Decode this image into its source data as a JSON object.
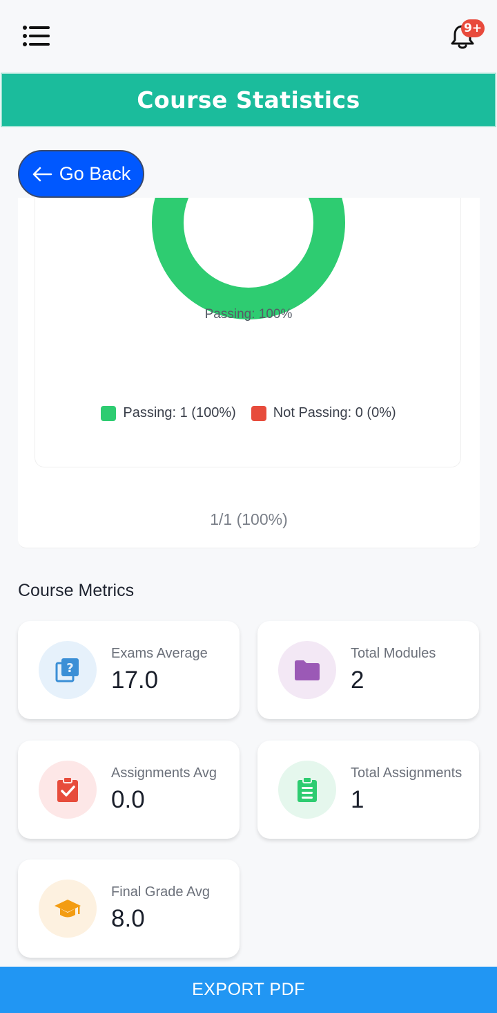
{
  "header": {
    "menu_icon": "menu-list-icon",
    "notification_icon": "bell-icon",
    "notification_badge": "9+",
    "title": "Course Statistics"
  },
  "go_back": {
    "label": "Go Back",
    "icon": "arrow-left-icon"
  },
  "chart_data": {
    "type": "pie",
    "categories": [
      "Passing",
      "Not Passing"
    ],
    "values": [
      1,
      0
    ],
    "percents": [
      100,
      0
    ],
    "colors": [
      "#2ecc71",
      "#e74c3c"
    ],
    "slice_label": "Passing: 100%",
    "legend": [
      "Passing: 1 (100%)",
      "Not Passing: 0 (0%)"
    ],
    "summary": "1/1 (100%)"
  },
  "metrics": {
    "title": "Course Metrics",
    "items": [
      {
        "label": "Exams Average",
        "value": "17.0",
        "icon": "quiz-icon",
        "icon_color": "#3b8fd6",
        "icon_bg": "#e6f1fb"
      },
      {
        "label": "Total Modules",
        "value": "2",
        "icon": "folder-icon",
        "icon_color": "#9b59b6",
        "icon_bg": "#f3e8f5"
      },
      {
        "label": "Assignments Avg",
        "value": "0.0",
        "icon": "clipboard-check-icon",
        "icon_color": "#e74c3c",
        "icon_bg": "#fde7e7"
      },
      {
        "label": "Total Assignments",
        "value": "1",
        "icon": "clipboard-list-icon",
        "icon_color": "#2ecc71",
        "icon_bg": "#e5f7ed"
      },
      {
        "label": "Final Grade Avg",
        "value": "8.0",
        "icon": "graduation-cap-icon",
        "icon_color": "#f39c12",
        "icon_bg": "#fdf1e0"
      }
    ]
  },
  "export": {
    "label": "EXPORT PDF"
  }
}
